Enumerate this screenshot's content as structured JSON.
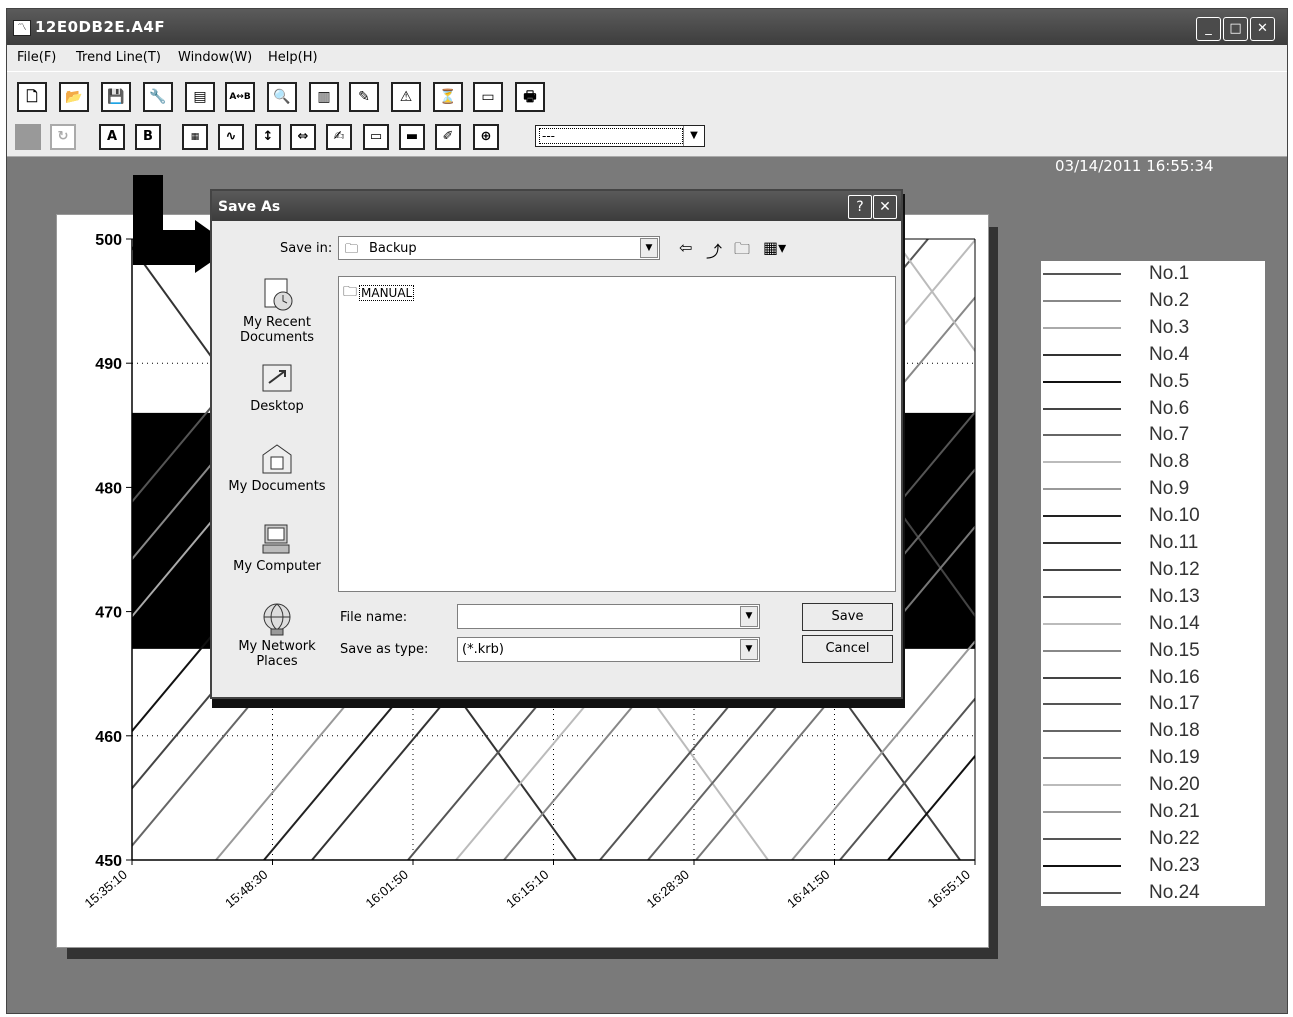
{
  "window": {
    "title": "12E0DB2E.A4F",
    "minimize": "_",
    "maximize": "□",
    "close": "✕"
  },
  "menu": [
    "File(F)",
    "Trend Line(T)",
    "Window(W)",
    "Help(H)"
  ],
  "toolbar2": {
    "btn_a": "A",
    "btn_b": "B",
    "selected": "---"
  },
  "datetime": "03/14/2011 16:55:34",
  "chart_data": {
    "type": "line",
    "ylim": [
      450,
      500
    ],
    "y_ticks": [
      "500",
      "490",
      "480",
      "470",
      "460",
      "450"
    ],
    "x_ticks": [
      "15:35:10",
      "15:48:30",
      "16:01:50",
      "16:15:10",
      "16:28:30",
      "16:41:50",
      "16:55:10"
    ],
    "grid": true,
    "band": [
      467,
      486
    ],
    "legend_placement": "right",
    "series_colors": [
      "#555555",
      "#888888",
      "#aaaaaa",
      "#333333",
      "#111111",
      "#444444",
      "#666666",
      "#bbbbbb",
      "#999999",
      "#222222",
      "#333333",
      "#444444",
      "#555555",
      "#bbbbbb",
      "#888888",
      "#444444",
      "#555555",
      "#666666",
      "#777777",
      "#bbbbbb",
      "#999999",
      "#555555",
      "#111111",
      "#555555"
    ]
  },
  "legend": [
    "No.1",
    "No.2",
    "No.3",
    "No.4",
    "No.5",
    "No.6",
    "No.7",
    "No.8",
    "No.9",
    "No.10",
    "No.11",
    "No.12",
    "No.13",
    "No.14",
    "No.15",
    "No.16",
    "No.17",
    "No.18",
    "No.19",
    "No.20",
    "No.21",
    "No.22",
    "No.23",
    "No.24"
  ],
  "dialog": {
    "title": "Save As",
    "help": "?",
    "close": "✕",
    "save_in_label": "Save in:",
    "save_in_value": "Backup",
    "files": [
      "MANUAL"
    ],
    "places": [
      "My Recent Documents",
      "Desktop",
      "My Documents",
      "My Computer",
      "My Network Places"
    ],
    "file_name_label": "File name:",
    "file_name_value": "",
    "save_type_label": "Save as type:",
    "save_type_value": "(*.krb)",
    "save_button": "Save",
    "cancel_button": "Cancel"
  }
}
